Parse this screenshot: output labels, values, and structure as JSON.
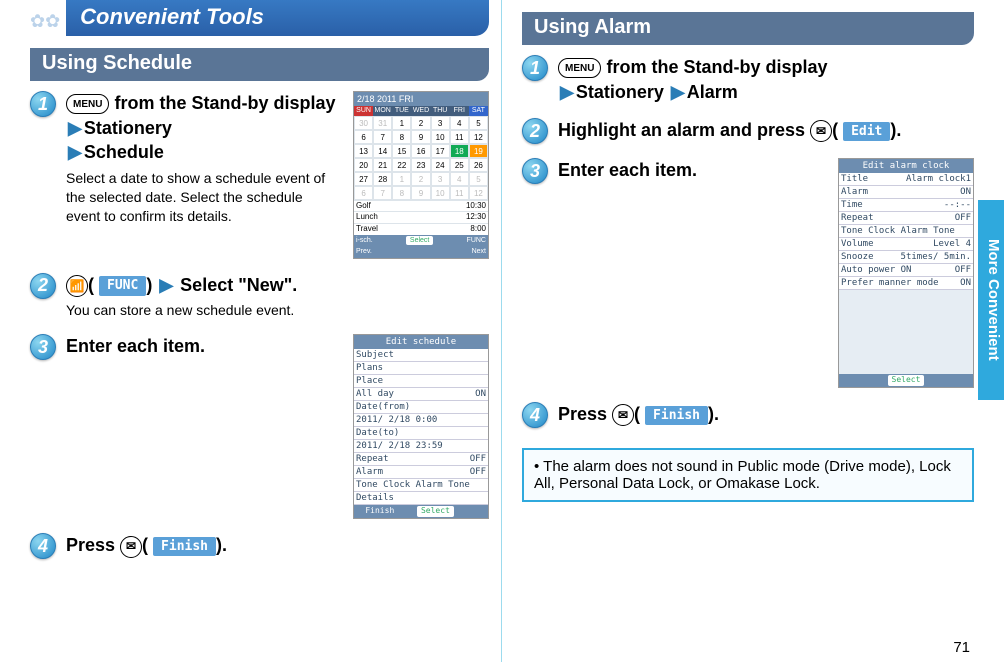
{
  "chapter_title": "Convenient Tools",
  "side_tab": "More Convenient",
  "page_number": "71",
  "left": {
    "section_title": "Using Schedule",
    "steps": [
      {
        "num": "1",
        "key_text": "MENU",
        "line1_a": " from the Stand-by display",
        "line1_b": "Stationery",
        "line1_c": "Schedule",
        "sub": "Select a date to show a schedule event of the selected date. Select the schedule event to confirm its details."
      },
      {
        "num": "2",
        "key_icon": "ir",
        "soft_label": "FUNC",
        "line_tail": "Select \"New\".",
        "sub": "You can store a new schedule event."
      },
      {
        "num": "3",
        "bold_line": "Enter each item."
      },
      {
        "num": "4",
        "line_prefix": "Press ",
        "key_icon": "mail",
        "soft_label": "Finish",
        "line_suffix": "."
      }
    ],
    "calendar": {
      "title": "2/18  2011  FRI",
      "days": [
        "SUN",
        "MON",
        "TUE",
        "WED",
        "THU",
        "FRI",
        "SAT"
      ],
      "grid": [
        "30",
        "31",
        "1",
        "2",
        "3",
        "4",
        "5",
        "6",
        "7",
        "8",
        "9",
        "10",
        "11",
        "12",
        "13",
        "14",
        "15",
        "16",
        "17",
        "18",
        "19",
        "20",
        "21",
        "22",
        "23",
        "24",
        "25",
        "26",
        "27",
        "28",
        "1",
        "2",
        "3",
        "4",
        "5",
        "6",
        "7",
        "8",
        "9",
        "10",
        "11",
        "12"
      ],
      "highlight_index": 19,
      "today_index": 20,
      "events": [
        {
          "label": "Golf",
          "time": "10:30"
        },
        {
          "label": "Lunch",
          "time": "12:30"
        },
        {
          "label": "Travel",
          "time": "8:00"
        }
      ],
      "footer_left": "i-sch.",
      "footer_mid": "Select",
      "footer_right": "FUNC",
      "footer_prev": "Prev.",
      "footer_next": "Next"
    },
    "edit_schedule": {
      "title": "Edit schedule",
      "rows": [
        {
          "l": "Subject",
          "r": ""
        },
        {
          "l": "Plans",
          "r": ""
        },
        {
          "l": "Place",
          "r": ""
        },
        {
          "l": "All day",
          "r": "ON"
        },
        {
          "l": "Date(from)",
          "r": ""
        },
        {
          "l": " 2011/ 2/18  0:00",
          "r": ""
        },
        {
          "l": "Date(to)",
          "r": ""
        },
        {
          "l": " 2011/ 2/18 23:59",
          "r": ""
        },
        {
          "l": "Repeat",
          "r": "OFF"
        },
        {
          "l": "Alarm",
          "r": "OFF"
        },
        {
          "l": "Tone  Clock Alarm Tone",
          "r": ""
        },
        {
          "l": "Details",
          "r": ""
        }
      ],
      "footer_left": "Finish",
      "footer_mid": "Select"
    }
  },
  "right": {
    "section_title": "Using Alarm",
    "steps": [
      {
        "num": "1",
        "key_text": "MENU",
        "line1_a": " from the Stand-by display",
        "line1_b": "Stationery",
        "line1_c": "Alarm"
      },
      {
        "num": "2",
        "bold_pre": "Highlight an alarm and press ",
        "key_icon": "mail",
        "soft_label": "Edit",
        "bold_post": "."
      },
      {
        "num": "3",
        "bold_line": "Enter each item."
      },
      {
        "num": "4",
        "line_prefix": "Press ",
        "key_icon": "mail",
        "soft_label": "Finish",
        "line_suffix": "."
      }
    ],
    "edit_alarm": {
      "title": "Edit alarm clock",
      "rows": [
        {
          "l": "Title",
          "r": "Alarm clock1"
        },
        {
          "l": "Alarm",
          "r": "ON"
        },
        {
          "l": "Time",
          "r": "--:--"
        },
        {
          "l": "Repeat",
          "r": "OFF"
        },
        {
          "l": "Tone  Clock Alarm Tone",
          "r": ""
        },
        {
          "l": "Volume",
          "r": "Level 4"
        },
        {
          "l": "Snooze",
          "r": "5times/ 5min."
        },
        {
          "l": "Auto power ON",
          "r": "OFF"
        },
        {
          "l": "Prefer manner mode",
          "r": "ON"
        }
      ],
      "footer_mid": "Select"
    },
    "note": "The alarm does not sound in Public mode (Drive mode), Lock All, Personal Data Lock, or Omakase Lock."
  }
}
